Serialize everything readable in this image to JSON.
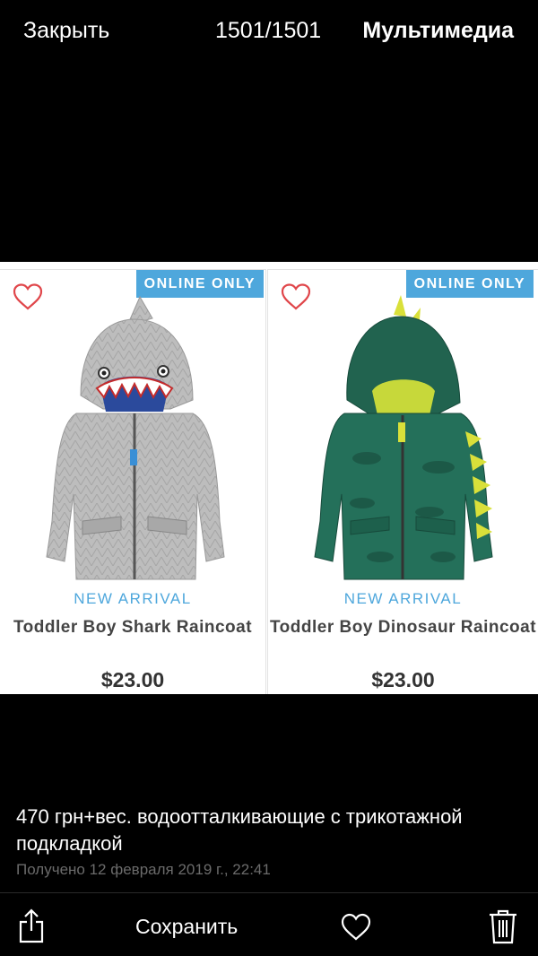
{
  "header": {
    "close_label": "Закрыть",
    "counter": "1501/1501",
    "media_label": "Мультимедиа"
  },
  "products": [
    {
      "badge": "ONLINE ONLY",
      "tag": "NEW ARRIVAL",
      "name": "Toddler Boy Shark Raincoat",
      "price": "$23.00",
      "icon": "shark-raincoat-image"
    },
    {
      "badge": "ONLINE ONLY",
      "tag": "NEW ARRIVAL",
      "name": "Toddler Boy Dinosaur Raincoat",
      "price": "$23.00",
      "icon": "dinosaur-raincoat-image"
    }
  ],
  "message": {
    "caption": "470 грн+вес. водоотталкивающие с трикотажной подкладкой",
    "received": "Получено 12 февраля 2019 г., 22:41"
  },
  "toolbar": {
    "save_label": "Сохранить",
    "share_icon": "share-icon",
    "favorite_icon": "heart-icon",
    "delete_icon": "trash-icon"
  },
  "colors": {
    "accent_blue": "#4ea7dc",
    "heart_red": "#e0464a",
    "background": "#000000"
  }
}
